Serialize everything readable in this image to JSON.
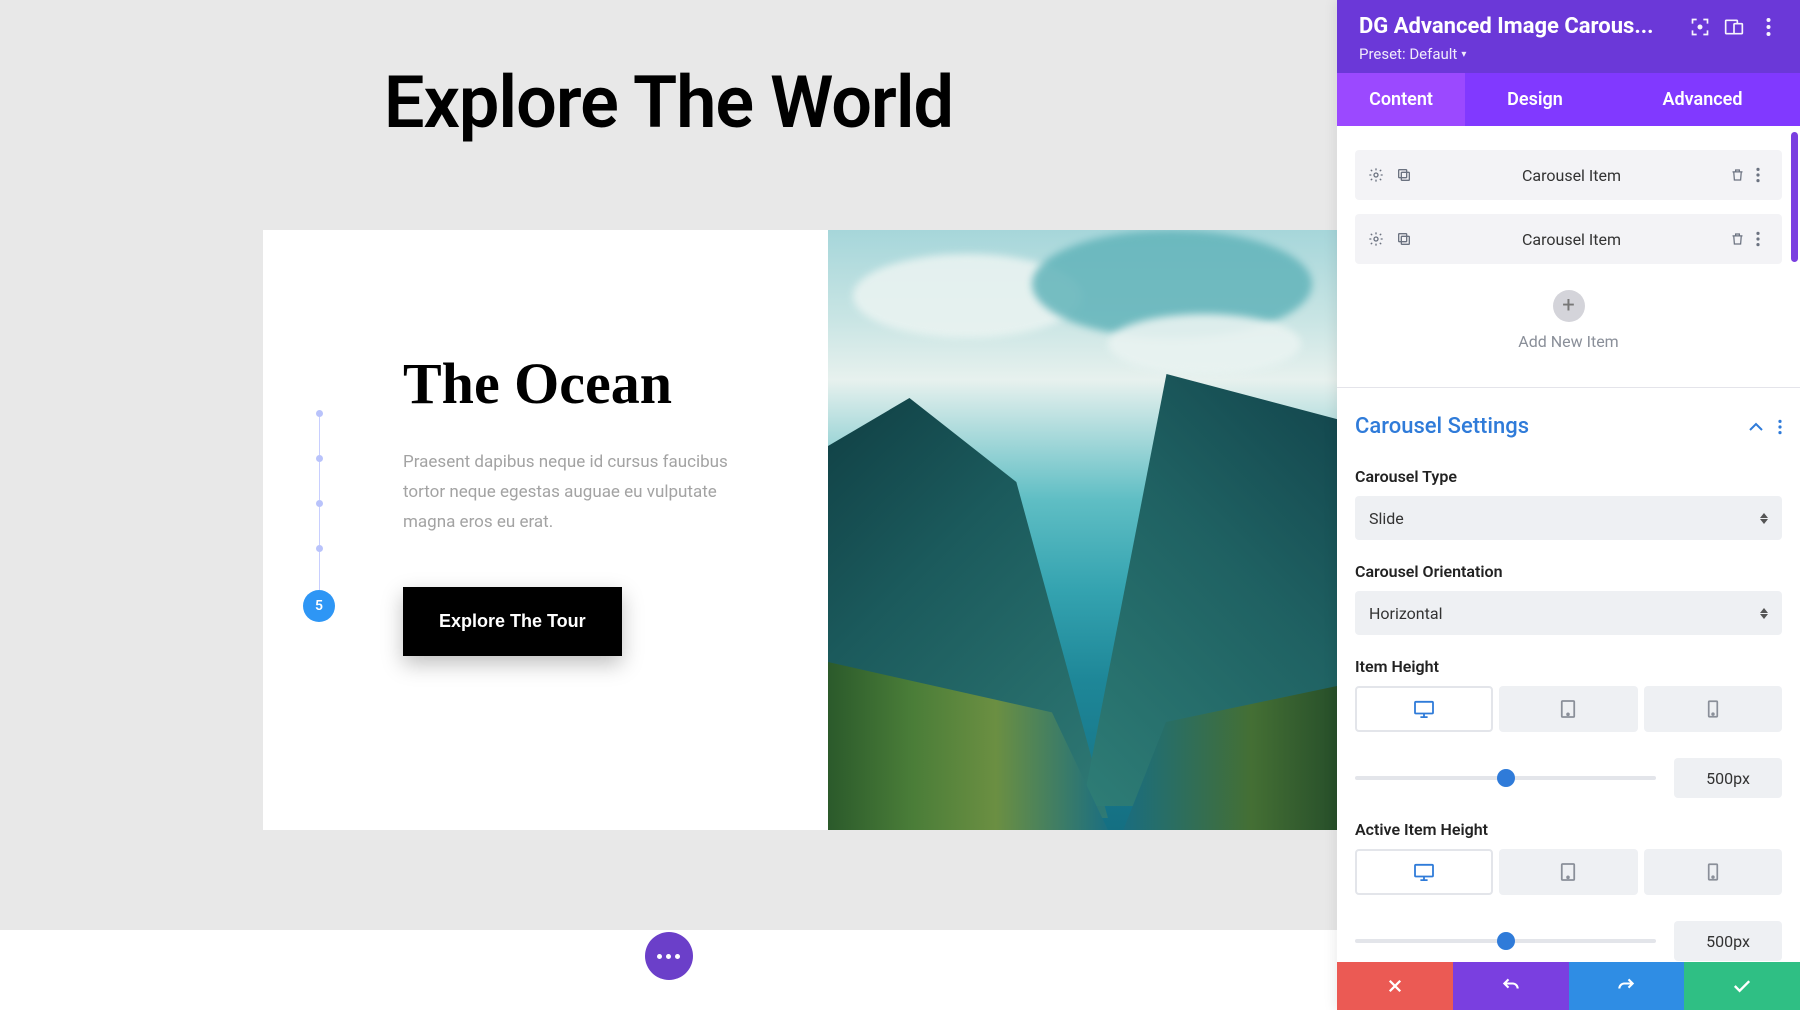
{
  "page": {
    "title": "Explore The World"
  },
  "hero": {
    "heading": "The Ocean",
    "body": "Praesent dapibus neque id cursus faucibus tortor neque egestas auguae eu vulputate magna eros eu erat.",
    "button": "Explore The Tour",
    "active_dot_label": "5"
  },
  "panel": {
    "title": "DG Advanced Image Carous...",
    "preset_label": "Preset: Default",
    "tabs": {
      "content": "Content",
      "design": "Design",
      "advanced": "Advanced"
    },
    "items": [
      {
        "label": "Carousel Item"
      },
      {
        "label": "Carousel Item"
      }
    ],
    "add_new": "Add New Item",
    "section_title": "Carousel Settings",
    "fields": {
      "carousel_type": {
        "label": "Carousel Type",
        "value": "Slide"
      },
      "orientation": {
        "label": "Carousel Orientation",
        "value": "Horizontal"
      },
      "item_height": {
        "label": "Item Height",
        "value": "500px",
        "percent": 50
      },
      "active_item_height": {
        "label": "Active Item Height",
        "value": "500px",
        "percent": 50
      }
    }
  }
}
